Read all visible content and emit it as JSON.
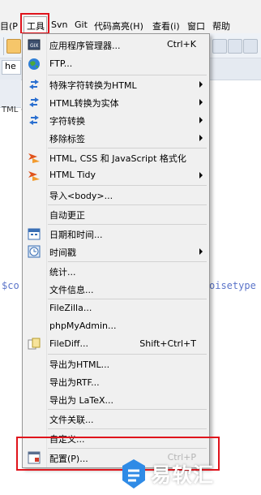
{
  "menubar": {
    "items": [
      "目(P",
      "工具",
      "Svn",
      "Git",
      "代码高亮(H)",
      "查看(i)",
      "窗口",
      "帮助"
    ]
  },
  "background": {
    "tab_text": "he",
    "side_text": "TML + ·",
    "code_left": "$co",
    "code_right": "oisetype"
  },
  "menu": {
    "items": [
      {
        "label": "应用程序管理器...",
        "shortcut": "Ctrl+K",
        "icon": "app-manager-icon"
      },
      {
        "label": "FTP...",
        "icon": "globe-icon"
      },
      {
        "label": "特殊字符转换为HTML",
        "submenu": true,
        "icon": "convert-arrows-icon"
      },
      {
        "label": "HTML转换为实体",
        "submenu": true,
        "icon": "convert-arrows-icon"
      },
      {
        "label": "字符转换",
        "submenu": true,
        "icon": "convert-arrows-icon"
      },
      {
        "label": "移除标签",
        "submenu": true
      },
      {
        "label": "HTML, CSS 和 JavaScript 格式化",
        "icon": "formatter-icon"
      },
      {
        "label": "HTML Tidy",
        "submenu": true,
        "icon": "tidy-icon"
      },
      {
        "label": "导入<body>..."
      },
      {
        "label": "自动更正"
      },
      {
        "label": "日期和时间...",
        "icon": "calendar-icon"
      },
      {
        "label": "时间戳",
        "submenu": true,
        "icon": "clock-icon"
      },
      {
        "label": "统计..."
      },
      {
        "label": "文件信息..."
      },
      {
        "label": "FileZilla..."
      },
      {
        "label": "phpMyAdmin..."
      },
      {
        "label": "FileDiff...",
        "shortcut": "Shift+Ctrl+T",
        "icon": "filediff-icon"
      },
      {
        "label": "导出为HTML..."
      },
      {
        "label": "导出为RTF..."
      },
      {
        "label": "导出为 LaTeX..."
      },
      {
        "label": "文件关联..."
      },
      {
        "label": "自定义..."
      },
      {
        "label": "配置(P)...",
        "shortcut": "Ctrl+P",
        "icon": "config-icon"
      }
    ]
  },
  "colors": {
    "highlight_box": "#e0141c",
    "menu_bg": "#f0f0f0",
    "code_blue": "#5b74c9",
    "watermark_blue": "#2f8be6"
  },
  "watermark": {
    "text": "易软汇"
  }
}
